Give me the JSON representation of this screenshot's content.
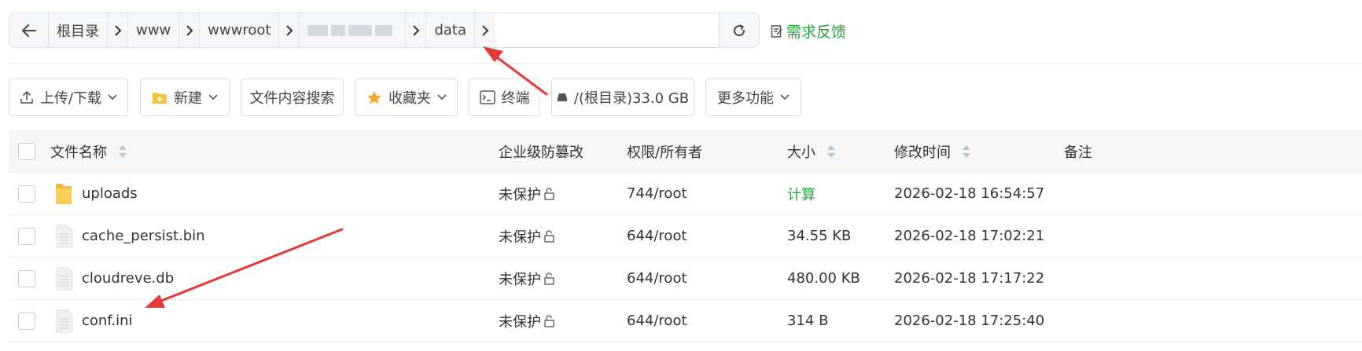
{
  "address_bar": {
    "crumbs": [
      "根目录",
      "www",
      "wwwroot",
      "data"
    ],
    "feedback_label": "需求反馈"
  },
  "toolbar": {
    "upload_label": "上传/下载",
    "new_label": "新建",
    "search_label": "文件内容搜索",
    "favorites_label": "收藏夹",
    "terminal_label": "终端",
    "disk_label": "/(根目录)33.0 GB",
    "more_label": "更多功能"
  },
  "table": {
    "headers": {
      "name": "文件名称",
      "protect": "企业级防篡改",
      "perm": "权限/所有者",
      "size": "大小",
      "mtime": "修改时间",
      "note": "备注"
    },
    "rows": [
      {
        "name": "uploads",
        "type": "folder",
        "protect": "未保护",
        "perm": "744/root",
        "size": "计算",
        "mtime": "2026-02-18 16:54:57"
      },
      {
        "name": "cache_persist.bin",
        "type": "file",
        "protect": "未保护",
        "perm": "644/root",
        "size": "34.55 KB",
        "mtime": "2026-02-18 17:02:21"
      },
      {
        "name": "cloudreve.db",
        "type": "file",
        "protect": "未保护",
        "perm": "644/root",
        "size": "480.00 KB",
        "mtime": "2026-02-18 17:17:22"
      },
      {
        "name": "conf.ini",
        "type": "file",
        "protect": "未保护",
        "perm": "644/root",
        "size": "314 B",
        "mtime": "2026-02-18 17:25:40"
      }
    ]
  },
  "colors": {
    "accent_green": "#20a53a",
    "annotation_red": "#e53935",
    "folder_yellow": "#f5c542"
  }
}
